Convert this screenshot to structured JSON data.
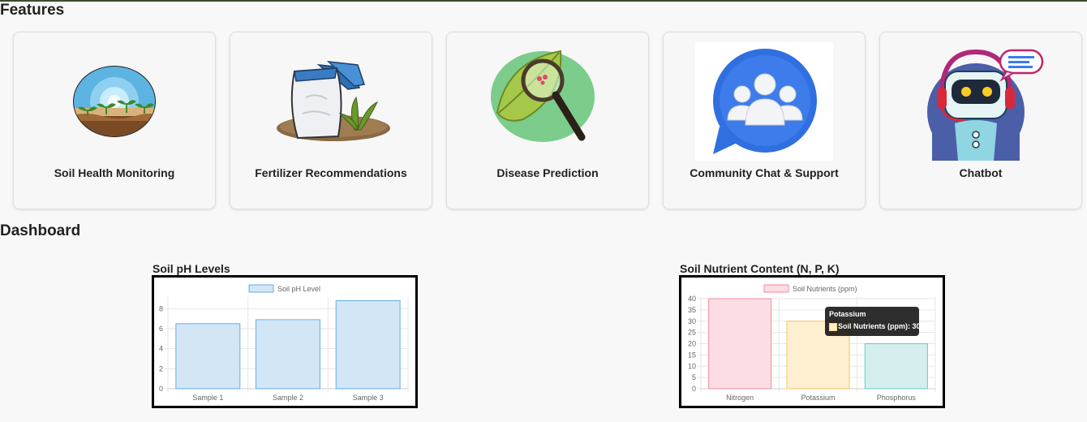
{
  "features": {
    "heading": "Features",
    "cards": [
      {
        "label": "Soil Health Monitoring",
        "icon": "soil-sprouts-icon"
      },
      {
        "label": "Fertilizer Recommendations",
        "icon": "fertilizer-bag-icon"
      },
      {
        "label": "Disease Prediction",
        "icon": "leaf-magnifier-icon"
      },
      {
        "label": "Community Chat & Support",
        "icon": "community-chat-icon"
      },
      {
        "label": "Chatbot",
        "icon": "robot-headset-icon"
      }
    ]
  },
  "dashboard": {
    "heading": "Dashboard",
    "ph_chart": {
      "title": "Soil pH Levels",
      "chart_data": {
        "type": "bar",
        "categories": [
          "Sample 1",
          "Sample 2",
          "Sample 3"
        ],
        "series": [
          {
            "name": "Soil pH Level",
            "values": [
              6.5,
              6.9,
              8.8
            ]
          }
        ],
        "y_ticks": [
          "0",
          "2",
          "4",
          "6",
          "8"
        ],
        "ylim": [
          0,
          9
        ],
        "grid": true,
        "legend": "top-center",
        "colors": {
          "fill": "#d2e6f6",
          "stroke": "#63aee6"
        }
      }
    },
    "nutrient_chart": {
      "title": "Soil Nutrient Content (N, P, K)",
      "chart_data": {
        "type": "bar",
        "categories": [
          "Nitrogen",
          "Potassium",
          "Phosphorus"
        ],
        "series": [
          {
            "name": "Soil Nutrients (ppm)",
            "values": [
              40,
              30,
              20
            ]
          }
        ],
        "y_ticks": [
          "0",
          "5",
          "10",
          "15",
          "20",
          "25",
          "30",
          "35",
          "40"
        ],
        "ylim": [
          0,
          40
        ],
        "grid": true,
        "legend": "top-center",
        "colors": {
          "fills": [
            "#fbdde3",
            "#fdefcf",
            "#d4eeee"
          ],
          "strokes": [
            "#f08aa0",
            "#f4c766",
            "#6cc7c7"
          ],
          "legend_fill": "#fbdde3",
          "legend_stroke": "#f08aa0"
        }
      },
      "tooltip": {
        "title": "Potassium",
        "body": "Soil Nutrients (ppm): 30"
      }
    }
  }
}
